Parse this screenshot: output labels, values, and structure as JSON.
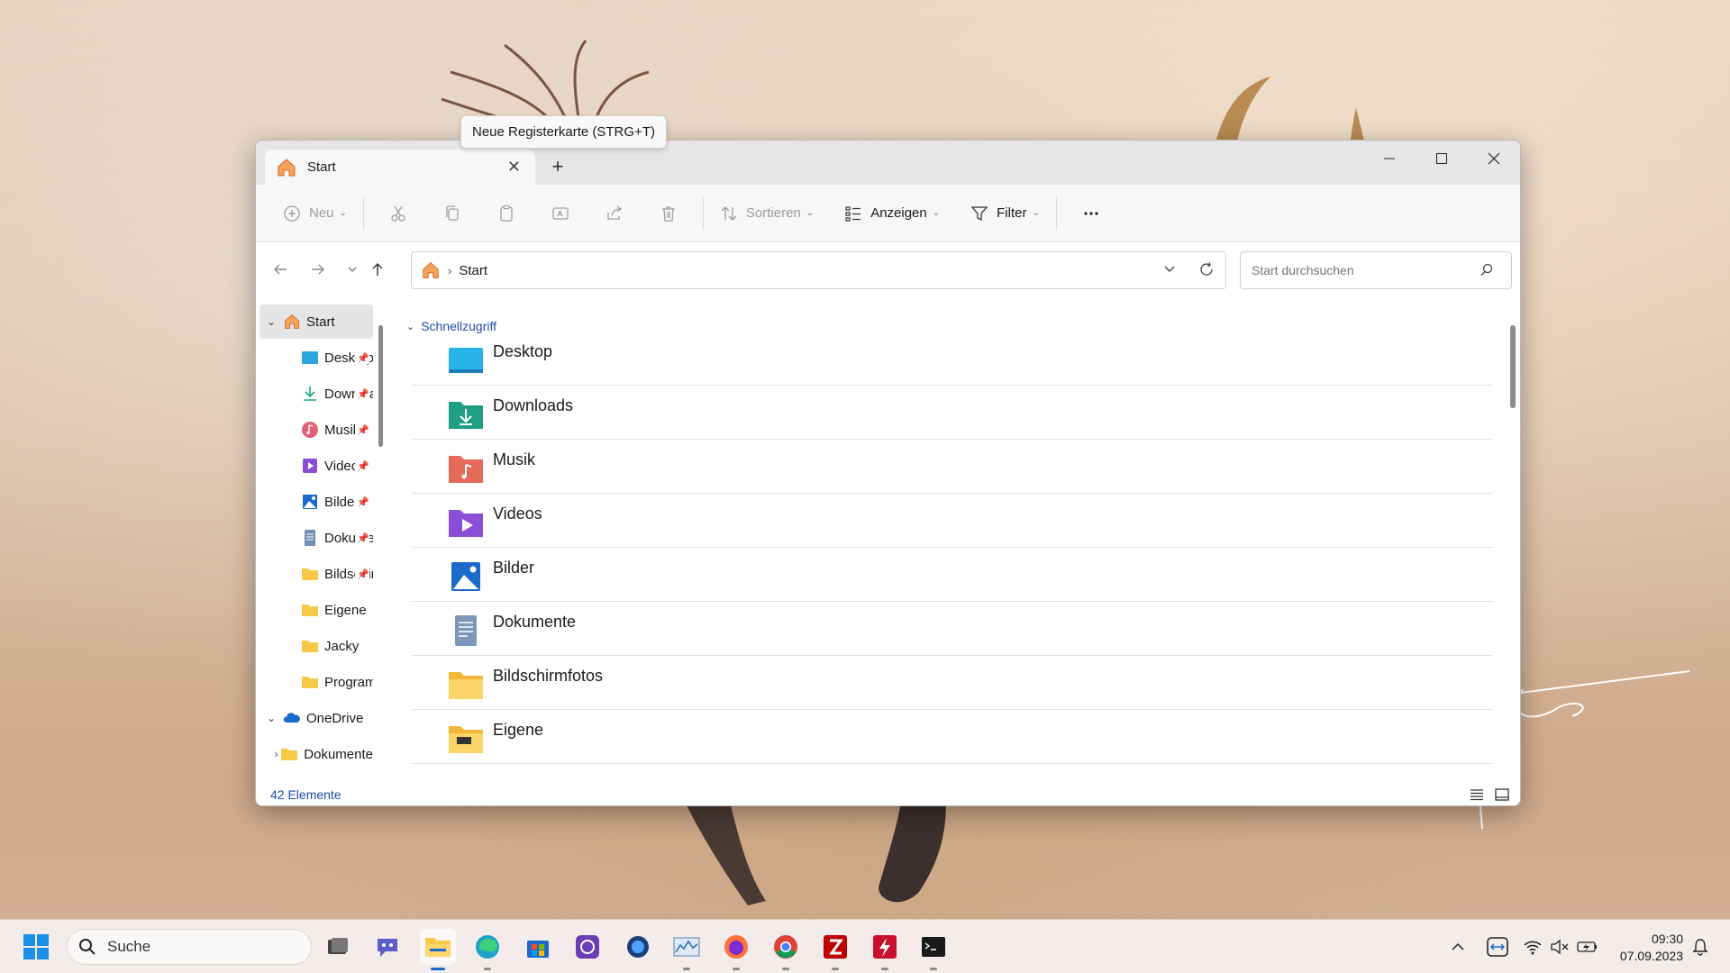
{
  "tooltip": "Neue Registerkarte (STRG+T)",
  "window": {
    "tab_title": "Start",
    "toolbar": {
      "new_label": "Neu",
      "sort_label": "Sortieren",
      "view_label": "Anzeigen",
      "filter_label": "Filter"
    },
    "address": {
      "crumb": "Start",
      "search_placeholder": "Start durchsuchen"
    },
    "sidebar": [
      {
        "label": "Start",
        "icon": "home-icon",
        "expanded": true,
        "selected": true
      },
      {
        "label": "Desktop",
        "icon": "desktop-folder-icon",
        "pinned": true
      },
      {
        "label": "Downloads",
        "icon": "download-icon",
        "pinned": true
      },
      {
        "label": "Musik",
        "icon": "music-icon",
        "pinned": true
      },
      {
        "label": "Videos",
        "icon": "video-icon",
        "pinned": true
      },
      {
        "label": "Bilder",
        "icon": "pictures-icon",
        "pinned": true
      },
      {
        "label": "Dokumente",
        "icon": "documents-icon",
        "pinned": true
      },
      {
        "label": "Bildschirmfotos",
        "icon": "folder-icon",
        "pinned": true
      },
      {
        "label": "Eigene",
        "icon": "folder-icon"
      },
      {
        "label": "Jacky",
        "icon": "folder-icon"
      },
      {
        "label": "Programme",
        "icon": "folder-icon"
      },
      {
        "label": "OneDrive",
        "icon": "cloud-icon",
        "expanded": true
      },
      {
        "label": "Dokumente",
        "icon": "folder-icon",
        "collapsed": true
      }
    ],
    "group_header": "Schnellzugriff",
    "items": [
      {
        "name": "Desktop",
        "icon": "desktop-folder-icon"
      },
      {
        "name": "Downloads",
        "icon": "downloads-folder-icon"
      },
      {
        "name": "Musik",
        "icon": "music-folder-icon"
      },
      {
        "name": "Videos",
        "icon": "videos-folder-icon"
      },
      {
        "name": "Bilder",
        "icon": "pictures-folder-icon"
      },
      {
        "name": "Dokumente",
        "icon": "documents-folder-icon"
      },
      {
        "name": "Bildschirmfotos",
        "icon": "folder-icon"
      },
      {
        "name": "Eigene",
        "icon": "folder-icon"
      }
    ],
    "status": "42 Elemente"
  },
  "taskbar": {
    "search_label": "Suche",
    "time": "09:30",
    "date": "07.09.2023"
  },
  "colors": {
    "accent": "#1b6ac9",
    "link_blue": "#1f4aa8",
    "folder_yellow": "#f7c948"
  }
}
